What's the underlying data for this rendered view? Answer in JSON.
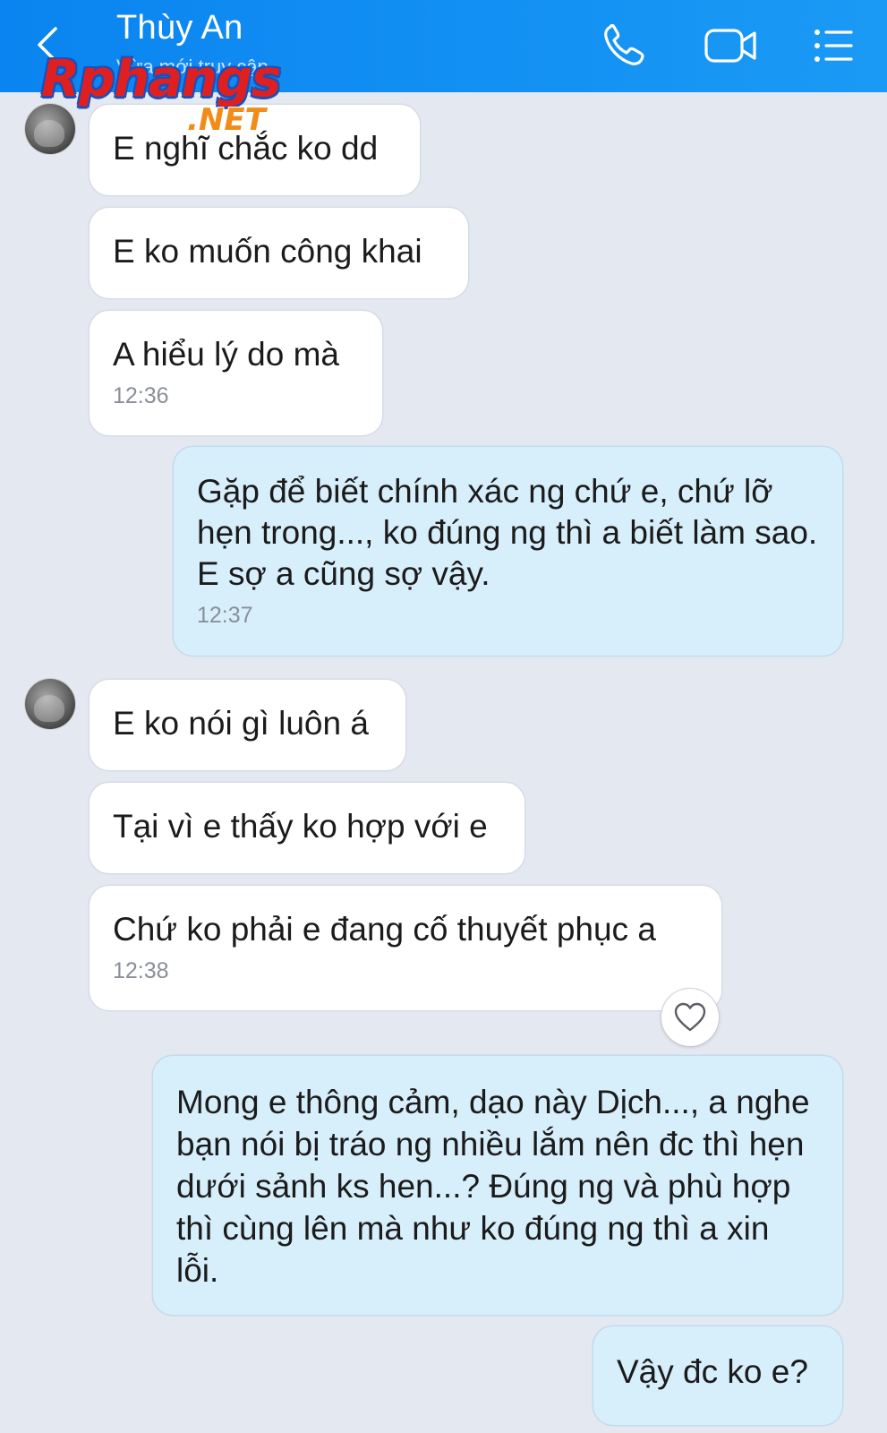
{
  "header": {
    "contact_name": "Thùy An",
    "status": "Vừa mới truy cập"
  },
  "watermark": {
    "main": "Rphangs",
    "sub": ".NET"
  },
  "messages": [
    {
      "text": "E nghĩ chắc ko dd",
      "time": ""
    },
    {
      "text": "E ko muốn công khai",
      "time": ""
    },
    {
      "text": "A hiểu lý do mà",
      "time": "12:36"
    },
    {
      "text": "Gặp để biết chính xác ng chứ e, chứ lỡ hẹn trong..., ko đúng ng thì a biết làm sao. E sợ a cũng sợ vậy.",
      "time": "12:37"
    },
    {
      "text": "E ko nói gì luôn á",
      "time": ""
    },
    {
      "text": "Tại vì e thấy ko hợp với e",
      "time": ""
    },
    {
      "text": "Chứ ko phải e đang cố thuyết phục a",
      "time": "12:38"
    },
    {
      "text": "Mong e thông cảm, dạo này Dịch..., a nghe bạn nói bị tráo ng nhiều lắm nên đc thì hẹn dưới sảnh ks hen...? Đúng ng và phù hợp thì cùng lên mà như ko đúng ng thì a xin lỗi.",
      "time": ""
    },
    {
      "text": "Vậy đc ko e?",
      "time": ""
    }
  ],
  "icons": {
    "back": "chevron-left-icon",
    "call": "phone-icon",
    "video": "video-camera-icon",
    "menu": "list-menu-icon",
    "react": "heart-icon"
  },
  "colors": {
    "header": "#0a84f0",
    "background": "#e4e8f1",
    "incoming_bubble": "#ffffff",
    "outgoing_bubble": "#d7eefb",
    "timestamp": "#8a8f98"
  }
}
